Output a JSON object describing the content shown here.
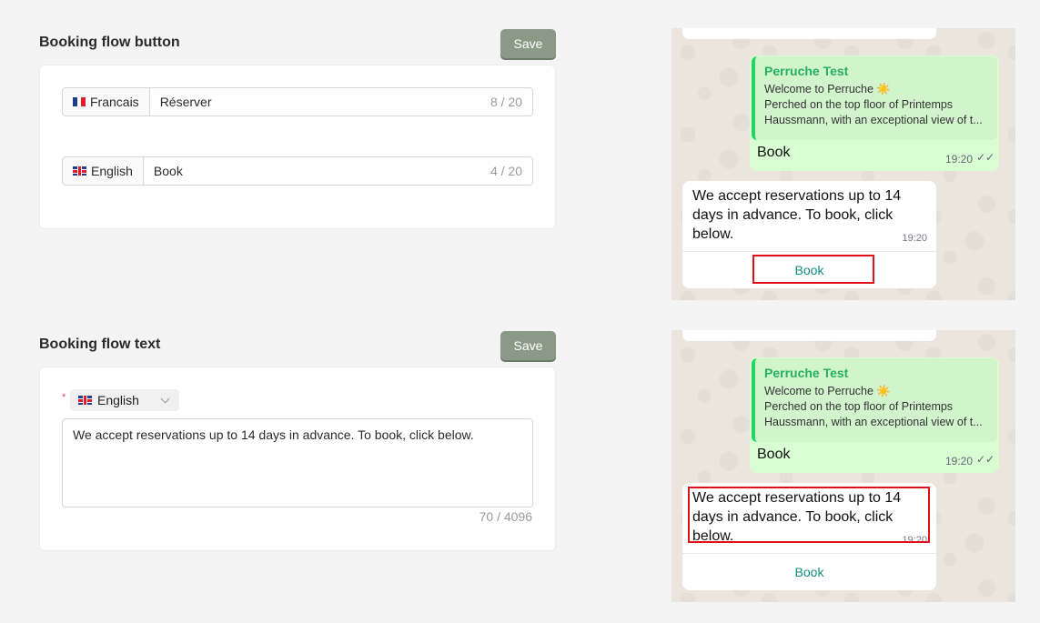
{
  "button_section": {
    "title": "Booking flow button",
    "save_label": "Save",
    "inputs": [
      {
        "flag": "fr",
        "language": "Francais",
        "value": "Réserver",
        "counter": "8 / 20"
      },
      {
        "flag": "gb",
        "language": "English",
        "value": "Book",
        "counter": "4 / 20"
      }
    ]
  },
  "text_section": {
    "title": "Booking flow text",
    "save_label": "Save",
    "required_mark": "*",
    "language": "English",
    "text": "We accept reservations up to 14 days in advance. To book, click below.",
    "counter": "70 / 4096"
  },
  "preview": {
    "sender": "Perruche Test",
    "quote_lines": [
      "Welcome to Perruche ☀️",
      "Perched on the top floor of Printemps",
      "Haussmann, with an exceptional view of t..."
    ],
    "reply": "Book",
    "time": "19:20",
    "message": "We accept reservations up to 14 days in advance. To book, click below.",
    "button": "Book"
  },
  "colors": {
    "accent_green": "#25d366",
    "button_text": "#128c7e",
    "highlight": "#e0101a",
    "save_button": "#8b9a87"
  }
}
